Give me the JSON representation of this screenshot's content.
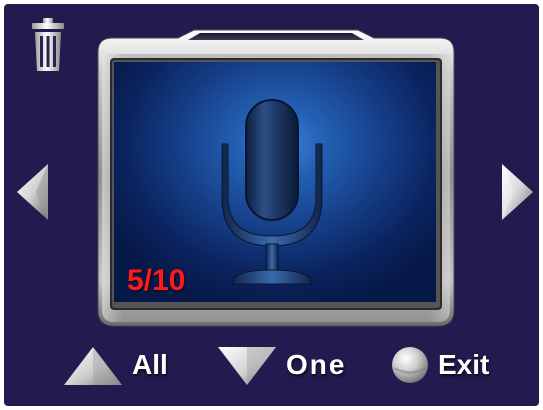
{
  "player": {
    "counter": "5/10",
    "display_icon": "microphone-icon"
  },
  "controls": {
    "all_label": "All",
    "one_label": "One",
    "exit_label": "Exit"
  },
  "icons": {
    "trash": "trash-icon",
    "prev": "arrow-left-icon",
    "next": "arrow-right-icon",
    "all": "triangle-up-icon",
    "one": "triangle-down-icon",
    "exit": "round-button-icon"
  },
  "colors": {
    "background": "#211b4f",
    "counter": "#ff1a1a",
    "display_glow": "#3f80d8"
  }
}
